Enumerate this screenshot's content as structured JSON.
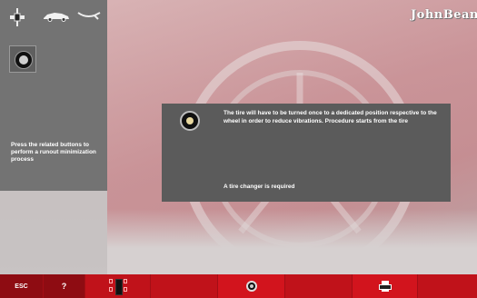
{
  "brand": {
    "logo_text": "JohnBean"
  },
  "left_panel": {
    "top_icons": [
      "balancer-weight-icon",
      "car-icon",
      "wrench-icon"
    ],
    "selected_icon": "wheel-icon",
    "hint_text": "Press the related buttons to perform a runout minimization process"
  },
  "dialog": {
    "icon": "wheel-icon",
    "message": "The tire will have to be turned once to a dedicated position respective to the wheel in order to reduce vibrations. Procedure starts from the tire",
    "note": "A tire changer is required"
  },
  "toolbar": {
    "esc_label": "ESC",
    "help_label": "?",
    "gauge_icon": "runout-gauge-icon",
    "wheel_icon": "wheel-icon",
    "print_icon": "printer-icon"
  },
  "colors": {
    "toolbar_red": "#c0121a",
    "panel_gray": "#737373",
    "dialog_gray": "#5b5b5b"
  }
}
